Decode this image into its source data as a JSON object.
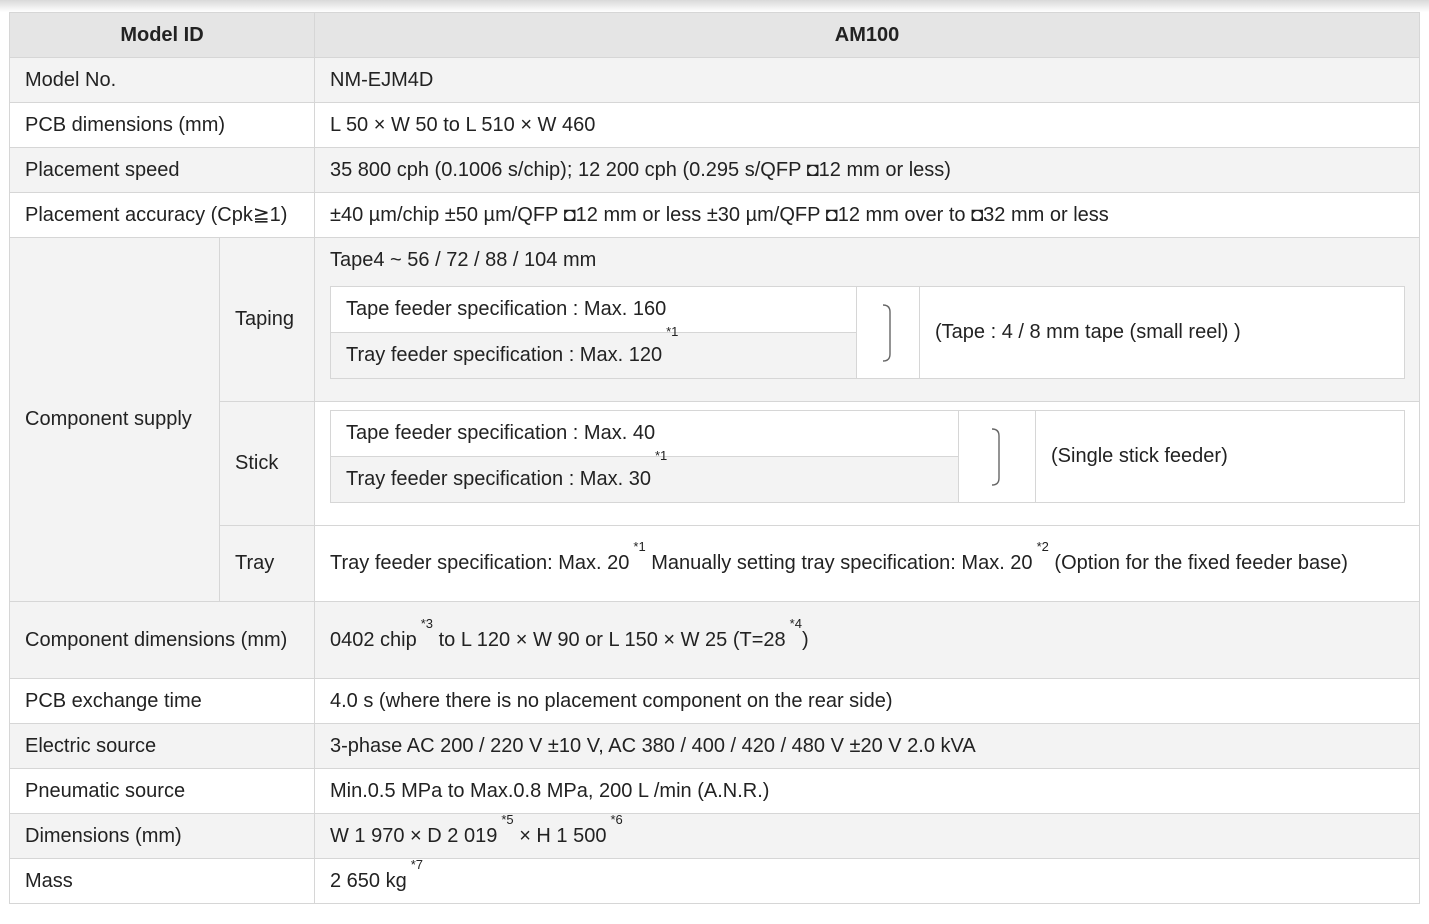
{
  "header": {
    "col1": "Model ID",
    "col2": "AM100"
  },
  "rows": {
    "model_no": {
      "label": "Model No.",
      "value": "NM-EJM4D"
    },
    "pcb_dims": {
      "label": "PCB dimensions (mm)",
      "value": "L 50 × W 50 to L 510 × W 460"
    },
    "placement_speed": {
      "label": "Placement speed",
      "value": "35 800 cph (0.1006 s/chip); 12 200 cph (0.295 s/QFP ◘12 mm or less)"
    },
    "placement_accuracy": {
      "label": "Placement accuracy (Cpk≧1)",
      "value": "±40 µm/chip ±50 µm/QFP ◘12 mm or less ±30 µm/QFP ◘12 mm over to ◘32 mm or less"
    },
    "component_supply": {
      "label": "Component supply",
      "taping": {
        "label": "Taping",
        "tape_line": "Tape4 ~ 56 / 72 / 88 / 104 mm",
        "tape_feeder": "Tape feeder specification : Max. 160",
        "tray_feeder": "Tray feeder specification : Max. 120",
        "tray_feeder_sup": "*1",
        "note": "(Tape : 4 / 8 mm tape (small reel) )"
      },
      "stick": {
        "label": "Stick",
        "tape_feeder": "Tape feeder specification : Max. 40",
        "tray_feeder": "Tray feeder specification : Max. 30",
        "tray_feeder_sup": "*1",
        "note": "(Single stick feeder)"
      },
      "tray": {
        "label": "Tray",
        "part1": "Tray feeder specification: Max. 20",
        "sup1": "*1",
        "part2": "Manually setting tray specification: Max. 20",
        "sup2": "*2",
        "part3": "(Option for the fixed feeder base)"
      }
    },
    "component_dims": {
      "label": "Component dimensions (mm)",
      "part1": "0402 chip",
      "sup1": "*3",
      "part2": "to L 120 × W 90 or L 150 × W 25 (T=28",
      "sup2": "*4",
      "part3": ")"
    },
    "pcb_exchange": {
      "label": "PCB exchange time",
      "value": "4.0 s (where there is no placement component on the rear side)"
    },
    "electric": {
      "label": "Electric source",
      "value": "3-phase AC 200 / 220 V ±10 V, AC 380 / 400 / 420 / 480 V ±20 V 2.0 kVA"
    },
    "pneumatic": {
      "label": "Pneumatic source",
      "value": "Min.0.5 MPa to Max.0.8 MPa, 200 L /min (A.N.R.)"
    },
    "dimensions": {
      "label": "Dimensions (mm)",
      "part1": "W 1 970 × D 2 019",
      "sup1": "*5",
      "part2": "× H 1 500",
      "sup2": "*6"
    },
    "mass": {
      "label": "Mass",
      "value": "2 650 kg",
      "sup": "*7"
    }
  }
}
